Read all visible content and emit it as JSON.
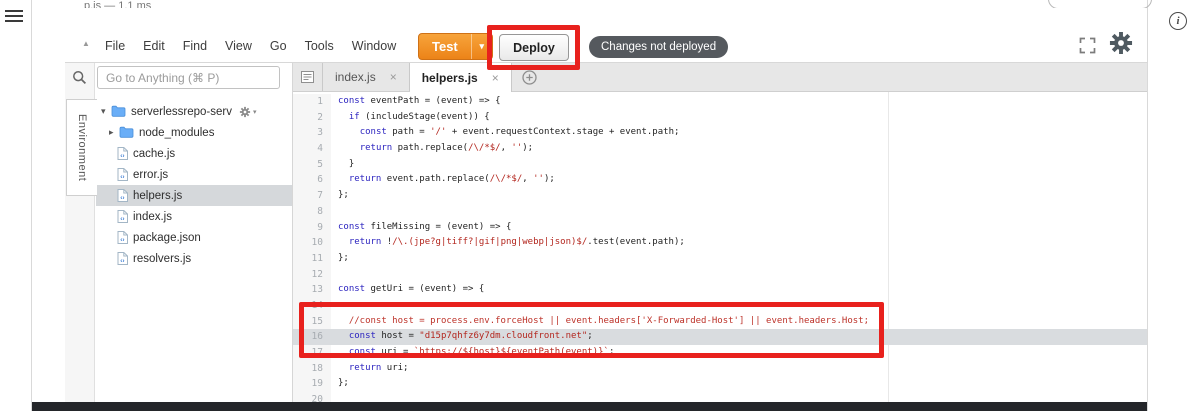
{
  "host_page": {
    "hamburger_icon": "menu",
    "info_button": "i",
    "clipped_top_fragment": "p.js — 1.1 ms"
  },
  "menubar": {
    "collapse_icon": "▲",
    "items": [
      "File",
      "Edit",
      "Find",
      "View",
      "Go",
      "Tools",
      "Window"
    ],
    "test_button": {
      "label": "Test",
      "caret": "▾"
    },
    "deploy_button": {
      "label": "Deploy"
    },
    "status_badge": {
      "label": "Changes not deployed"
    }
  },
  "goto_anything": {
    "placeholder": "Go to Anything (⌘ P)"
  },
  "left_dock": {
    "active_tab": "Environment"
  },
  "file_tree": {
    "items": [
      {
        "label": "serverlessrepo-serv",
        "type": "folder-open",
        "has_gear": true
      },
      {
        "label": "node_modules",
        "type": "folder-collapsed"
      },
      {
        "label": "cache.js",
        "type": "file"
      },
      {
        "label": "error.js",
        "type": "file"
      },
      {
        "label": "helpers.js",
        "type": "file",
        "selected": true
      },
      {
        "label": "index.js",
        "type": "file"
      },
      {
        "label": "package.json",
        "type": "file"
      },
      {
        "label": "resolvers.js",
        "type": "file"
      }
    ]
  },
  "editor": {
    "tabs": [
      {
        "label": "index.js",
        "active": false
      },
      {
        "label": "helpers.js",
        "active": true
      }
    ],
    "active_line": 16,
    "lines": [
      [
        [
          "kw",
          "const"
        ],
        [
          "pl",
          " eventPath = (event) => {"
        ]
      ],
      [
        [
          "pl",
          "  "
        ],
        [
          "kw",
          "if"
        ],
        [
          "pl",
          " (includeStage(event)) {"
        ]
      ],
      [
        [
          "pl",
          "    "
        ],
        [
          "kw",
          "const"
        ],
        [
          "pl",
          " path = "
        ],
        [
          "str",
          "'/'"
        ],
        [
          "pl",
          " + event.requestContext.stage + event.path;"
        ]
      ],
      [
        [
          "pl",
          "    "
        ],
        [
          "kw",
          "return"
        ],
        [
          "pl",
          " path.replace("
        ],
        [
          "str",
          "/\\/*$/"
        ],
        [
          "pl",
          ", "
        ],
        [
          "str",
          "''"
        ],
        [
          "pl",
          ");"
        ]
      ],
      [
        [
          "pl",
          "  }"
        ]
      ],
      [
        [
          "pl",
          "  "
        ],
        [
          "kw",
          "return"
        ],
        [
          "pl",
          " event.path.replace("
        ],
        [
          "str",
          "/\\/*$/"
        ],
        [
          "pl",
          ", "
        ],
        [
          "str",
          "''"
        ],
        [
          "pl",
          ");"
        ]
      ],
      [
        [
          "pl",
          "};"
        ]
      ],
      [],
      [
        [
          "kw",
          "const"
        ],
        [
          "pl",
          " fileMissing = (event) => {"
        ]
      ],
      [
        [
          "pl",
          "  "
        ],
        [
          "kw",
          "return"
        ],
        [
          "pl",
          " !"
        ],
        [
          "str",
          "/\\.(jpe?g|tiff?|gif|png|webp|json)$/"
        ],
        [
          "pl",
          ".test(event.path);"
        ]
      ],
      [
        [
          "pl",
          "};"
        ]
      ],
      [],
      [
        [
          "kw",
          "const"
        ],
        [
          "pl",
          " getUri = (event) => {"
        ]
      ],
      [],
      [
        [
          "com",
          "  //const host = process.env.forceHost || event.headers['X-Forwarded-Host'] || event.headers.Host;"
        ]
      ],
      [
        [
          "pl",
          "  "
        ],
        [
          "kw",
          "const"
        ],
        [
          "pl",
          " host = "
        ],
        [
          "str",
          "\"d15p7qhfz6y7dm.cloudfront.net\""
        ],
        [
          "pl",
          ";"
        ]
      ],
      [
        [
          "pl",
          "  "
        ],
        [
          "kw",
          "const"
        ],
        [
          "pl",
          " uri = "
        ],
        [
          "str",
          "`https://${host}${eventPath(event)}`"
        ],
        [
          "pl",
          ";"
        ]
      ],
      [
        [
          "pl",
          "  "
        ],
        [
          "kw",
          "return"
        ],
        [
          "pl",
          " uri;"
        ]
      ],
      [
        [
          "pl",
          "};"
        ]
      ],
      []
    ]
  },
  "annotations": {
    "color": "#e8211d",
    "boxes": [
      {
        "target": "deploy-button"
      },
      {
        "target": "code-lines-15-16"
      }
    ]
  },
  "colors": {
    "keyword": "#2b23bf",
    "string": "#b3261e",
    "comment": "#bd3229",
    "plain": "#1f1f1f",
    "test_button": "#ee8a20",
    "badge_bg": "#55595e"
  }
}
